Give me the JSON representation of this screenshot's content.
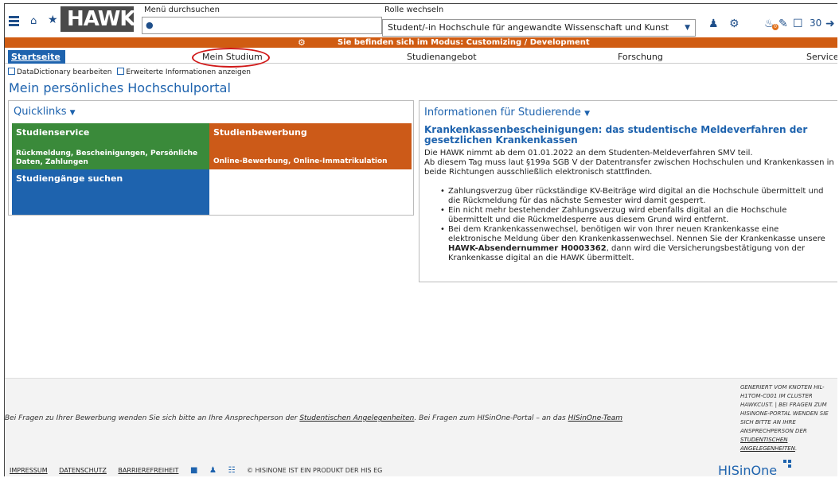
{
  "header": {
    "logo_text": "HAWK",
    "search_label": "Menü durchsuchen",
    "search_placeholder": "",
    "role_label": "Rolle wechseln",
    "role_value": "Student/-in Hochschule für angewandte Wissenschaft und Kunst",
    "notification_count": "0",
    "counter": "30"
  },
  "banner": {
    "text": "Sie befinden sich im Modus: Customizing / Development"
  },
  "nav": {
    "items": [
      "Startseite",
      "Mein Studium",
      "Studienangebot",
      "Forschung",
      "Service"
    ]
  },
  "options": {
    "data_dictionary": "DataDictionary bearbeiten",
    "extended_info": "Erweiterte Informationen anzeigen"
  },
  "page_title": "Mein persönliches Hochschulportal",
  "quicklinks": {
    "heading": "Quicklinks",
    "tiles": [
      {
        "title": "Studienservice",
        "subtitle": "Rückmeldung, Bescheinigungen, Persönliche Daten, Zahlungen",
        "color": "#3a8a3a"
      },
      {
        "title": "Studienbewerbung",
        "subtitle": "Online-Bewerbung, Online-Immatrikulation",
        "color": "#cc5a18"
      },
      {
        "title": "Studiengänge suchen",
        "subtitle": "",
        "color": "#1e63ae"
      }
    ]
  },
  "info": {
    "heading": "Informationen für Studierende",
    "title": "Krankenkassenbescheinigungen: das studentische Meldeverfahren der gesetzlichen Krankenkassen",
    "para1": "Die HAWK nimmt ab dem 01.01.2022 an dem Studenten-Meldeverfahren SMV teil.",
    "para2": "Ab diesem Tag muss laut §199a SGB V der Datentransfer zwischen Hochschulen und Krankenkassen in beide Richtungen ausschließlich elektronisch stattfinden.",
    "bullets": [
      "Zahlungsverzug über rückständige KV-Beiträge wird digital an die Hochschule übermittelt und die Rückmeldung für das nächste Semester wird damit gesperrt.",
      "Ein nicht mehr bestehender Zahlungsverzug wird ebenfalls digital an die Hochschule übermittelt und die Rückmeldesperre aus diesem Grund wird entfernt."
    ],
    "bullet3_pre": "Bei dem Krankenkassenwechsel, benötigen wir von Ihrer neuen Krankenkasse eine elektronische Meldung über den Krankenkassenwechsel. Nennen Sie der Krankenkasse unsere ",
    "bullet3_bold": "HAWK-Absendernummer H0003362",
    "bullet3_post": ", dann wird die Versicherungsbestätigung von der Krankenkasse digital an die HAWK übermittelt."
  },
  "footer": {
    "text_pre": "Bei Fragen zu Ihrer Bewerbung wenden Sie sich bitte an Ihre Ansprechperson der ",
    "link1": "Studentischen Angelegenheiten",
    "text_mid": ". Bei Fragen zum HISinOne-Portal – an das ",
    "link2": "HISinOne-Team",
    "links": [
      "Impressum",
      "Datenschutz",
      "Barrierefreiheit"
    ],
    "copyright": "© HISinOne ist ein Produkt der HIS eG",
    "right_text": "Generiert vom Knoten hil-h1tom-c001 im Cluster HAWKCUST. | Bei Fragen zum HISinOne-Portal wenden Sie sich bitte an Ihre Ansprechperson der ",
    "right_link": "Studentischen Angelegenheiten",
    "right_end": ".",
    "brand": "HISinOne"
  }
}
